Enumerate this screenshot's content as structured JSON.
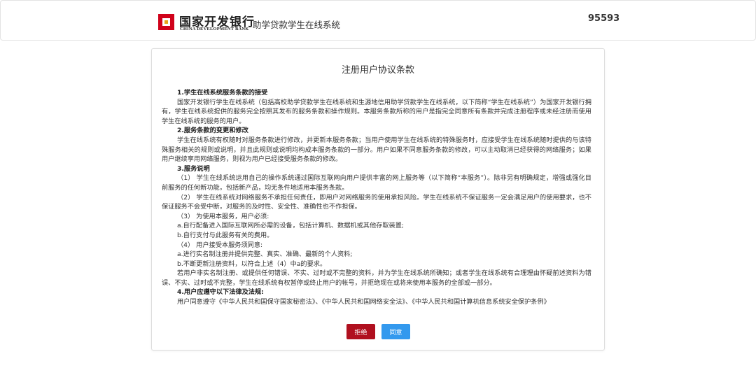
{
  "colors": {
    "brand_red": "#d0021b",
    "reject_button": "#b0101f",
    "agree_button": "#3399ee"
  },
  "header": {
    "logo_icon": "china-development-bank-logo",
    "brand_cn": "国家开发银行",
    "brand_en": "CHINA DEVELOPMENT BANK",
    "system_name": "助学贷款学生在线系统",
    "hotline": "95593"
  },
  "panel": {
    "title": "注册用户协议条款",
    "sections": [
      {
        "heading": "1.学生在线系统服务条款的接受",
        "paragraphs": [
          "国家开发银行学生在线系统（包括高校助学贷款学生在线系统和生源地信用助学贷款学生在线系统，以下简称“学生在线系统”）为国家开发银行拥有，学生在线系统提供的服务完全按照其发布的服务条款和操作规则。本服务条款所称的用户是指完全同意所有条款并完成注册程序或未经注册而使用学生在线系统的服务的用户。"
        ]
      },
      {
        "heading": "2.服务条款的变更和修改",
        "paragraphs": [
          "学生在线系统有权随时对服务条款进行修改，并更新本服务条款；当用户使用学生在线系统的特殊服务时，应接受学生在线系统随时提供的与该特殊服务相关的规则或说明，并且此规则或说明均构成本服务条款的一部分。用户如果不同意服务条款的修改，可以主动取消已经获得的网络服务；如果用户继续享用网络服务，则视为用户已经接受服务条款的修改。"
        ]
      },
      {
        "heading": "3.服务说明",
        "paragraphs": [
          "（1） 学生在线系统运用自己的操作系统通过国际互联网向用户提供丰富的网上服务等（以下简称“本服务”）。除非另有明确规定，增强或强化目前服务的任何新功能，包括新产品，均无条件地适用本服务条款。",
          "（2） 学生在线系统对网络服务不承担任何责任，即用户对网络服务的使用承担风险。学生在线系统不保证服务一定会满足用户的使用要求，也不保证服务不会受中断，对服务的及时性、安全性、准确性也不作担保。",
          "（3） 为使用本服务，用户必须:",
          "a.自行配备进入国际互联网所必需的设备，包括计算机、数据机或其他存取装置;",
          "b.自行支付与此服务有关的费用。",
          "（4） 用户接受本服务须同意:",
          "a.进行实名制注册并提供完整、真实、准确、最新的个人资料;",
          "b.不断更新注册资料，以符合上述（4）中a的要求。",
          "若用户非实名制注册、或提供任何错误、不实、过时或不完整的资料，并为学生在线系统所确知；或者学生在线系统有合理理由怀疑前述资料为错误、不实、过时或不完整，学生在线系统有权暂停或终止用户的帐号，并拒绝现在或将来使用本服务的全部或一部分。"
        ]
      },
      {
        "heading": "4.用户应遵守以下法律及法规:",
        "paragraphs": [
          "用户同意遵守《中华人民共和国保守国家秘密法》、《中华人民共和国网络安全法》、《中华人民共和国计算机信息系统安全保护条例》"
        ]
      }
    ],
    "reject_label": "拒绝",
    "agree_label": "同意"
  }
}
